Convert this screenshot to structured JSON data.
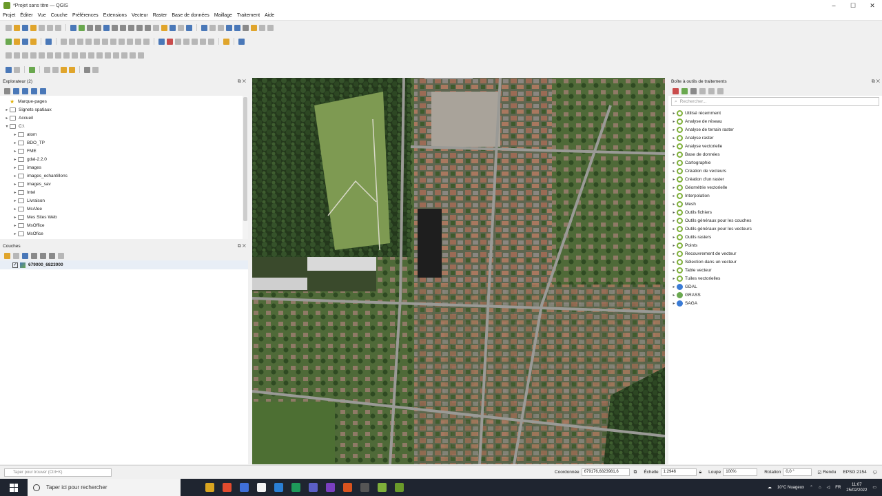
{
  "window": {
    "title": "*Projet sans titre — QGIS",
    "buttons": [
      "–",
      "☐",
      "✕"
    ]
  },
  "menu": [
    "Projet",
    "Éditer",
    "Vue",
    "Couche",
    "Préférences",
    "Extensions",
    "Vecteur",
    "Raster",
    "Base de données",
    "Maillage",
    "Traitement",
    "Aide"
  ],
  "browser": {
    "title": "Explorateur (2)",
    "items": [
      {
        "label": "Marque-pages",
        "depth": 0,
        "type": "star",
        "arrow": ""
      },
      {
        "label": "Signets spatiaux",
        "depth": 0,
        "type": "folder",
        "arrow": "▸"
      },
      {
        "label": "Accueil",
        "depth": 0,
        "type": "folder",
        "arrow": "▸"
      },
      {
        "label": "C:\\",
        "depth": 0,
        "type": "folder",
        "arrow": "▾"
      },
      {
        "label": "atom",
        "depth": 1,
        "type": "folder",
        "arrow": "▸"
      },
      {
        "label": "BDO_TP",
        "depth": 1,
        "type": "folder",
        "arrow": "▸"
      },
      {
        "label": "FME",
        "depth": 1,
        "type": "folder",
        "arrow": "▸"
      },
      {
        "label": "gdal-2.2.0",
        "depth": 1,
        "type": "folder",
        "arrow": "▸"
      },
      {
        "label": "images",
        "depth": 1,
        "type": "folder",
        "arrow": "▸"
      },
      {
        "label": "images_echantillons",
        "depth": 1,
        "type": "folder",
        "arrow": "▸"
      },
      {
        "label": "images_sav",
        "depth": 1,
        "type": "folder",
        "arrow": "▸"
      },
      {
        "label": "Intel",
        "depth": 1,
        "type": "folder",
        "arrow": "▸"
      },
      {
        "label": "Livraison",
        "depth": 1,
        "type": "folder",
        "arrow": "▸"
      },
      {
        "label": "McAfee",
        "depth": 1,
        "type": "folder",
        "arrow": "▸"
      },
      {
        "label": "Mes Sites Web",
        "depth": 1,
        "type": "folder",
        "arrow": "▸"
      },
      {
        "label": "MsOffice",
        "depth": 1,
        "type": "folder",
        "arrow": "▸"
      },
      {
        "label": "MsOfice",
        "depth": 1,
        "type": "folder",
        "arrow": "▸"
      }
    ]
  },
  "layers": {
    "title": "Couches",
    "items": [
      {
        "label": "679000_6823000",
        "checked": true
      }
    ]
  },
  "toolbox": {
    "title": "Boîte à outils de traitements",
    "search_placeholder": "Rechercher...",
    "items": [
      {
        "label": "Utilisé récemment",
        "type": "gear"
      },
      {
        "label": "Analyse de réseau",
        "type": "gear"
      },
      {
        "label": "Analyse de terrain raster",
        "type": "gear"
      },
      {
        "label": "Analyse raster",
        "type": "gear"
      },
      {
        "label": "Analyse vectorielle",
        "type": "gear"
      },
      {
        "label": "Base de données",
        "type": "gear"
      },
      {
        "label": "Cartographie",
        "type": "gear"
      },
      {
        "label": "Création de vecteurs",
        "type": "gear"
      },
      {
        "label": "Création d'un raster",
        "type": "gear"
      },
      {
        "label": "Géométrie vectorielle",
        "type": "gear"
      },
      {
        "label": "Interpolation",
        "type": "gear"
      },
      {
        "label": "Mesh",
        "type": "gear"
      },
      {
        "label": "Outils fichiers",
        "type": "gear"
      },
      {
        "label": "Outils généraux pour les couches",
        "type": "gear"
      },
      {
        "label": "Outils généraux pour les vecteurs",
        "type": "gear"
      },
      {
        "label": "Outils rasters",
        "type": "gear"
      },
      {
        "label": "Points",
        "type": "gear"
      },
      {
        "label": "Recouvrement de vecteur",
        "type": "gear"
      },
      {
        "label": "Sélection dans un vecteur",
        "type": "gear"
      },
      {
        "label": "Table vecteur",
        "type": "gear"
      },
      {
        "label": "Tuiles vectorielles",
        "type": "gear"
      },
      {
        "label": "GDAL",
        "type": "provider",
        "color": "#3a7bd5"
      },
      {
        "label": "GRASS",
        "type": "provider",
        "color": "#6aa84f"
      },
      {
        "label": "SAGA",
        "type": "provider",
        "color": "#3a7bd5"
      }
    ]
  },
  "status": {
    "locator_placeholder": "Taper pour trouver (Ctrl+K)",
    "coord_label": "Coordonnée",
    "coord_value": "679176,6823981,6",
    "scale_label": "Échelle",
    "scale_value": "1:2946",
    "magnifier_label": "Loupe",
    "magnifier_value": "100%",
    "rotation_label": "Rotation",
    "rotation_value": "0,0 °",
    "render_label": "Rendu",
    "crs_label": "EPSG:2154"
  },
  "taskbar": {
    "search_placeholder": "Taper ici pour rechercher",
    "weather": "10°C Nuageux",
    "lang": "FR",
    "time": "11:07",
    "date": "25/02/2022",
    "apps": [
      "#d9a520",
      "#e24b2e",
      "#3f6fd8",
      "#f3f3f3",
      "#2a7fd4",
      "#1e9a5a",
      "#5b5fc7",
      "#7a3fbf",
      "#d9531e",
      "#555555",
      "#7fb03a",
      "#6a9a2a"
    ]
  }
}
